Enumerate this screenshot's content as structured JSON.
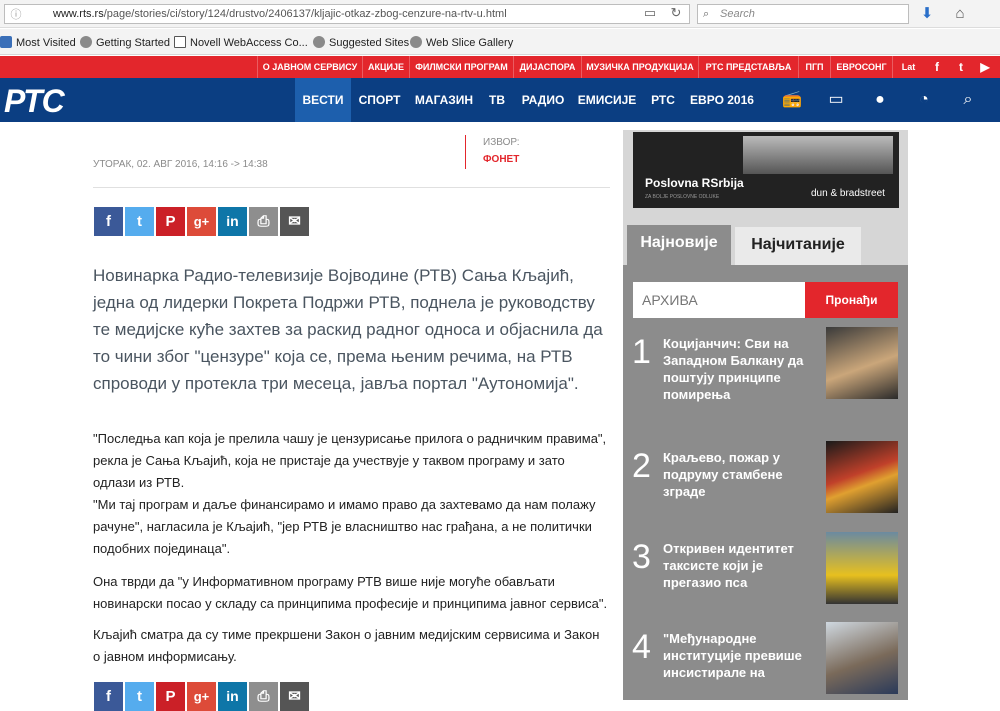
{
  "browser": {
    "url_host": "www.rts.rs",
    "url_path": "/page/stories/ci/story/124/drustvo/2406137/kljajic-otkaz-zbog-cenzure-na-rtv-u.html",
    "search_placeholder": "Search",
    "bookmarks": [
      "Most Visited",
      "Getting Started",
      "Novell WebAccess Co...",
      "Suggested Sites",
      "Web Slice Gallery"
    ]
  },
  "topnav": {
    "items": [
      "О ЈАВНОМ СЕРВИСУ",
      "АКЦИЈЕ",
      "ФИЛМСКИ ПРОГРАМ",
      "ДИЈАСПОРА",
      "МУЗИЧКА ПРОДУКЦИЈА",
      "РТС ПРЕДСТАВЉА",
      "ПГП",
      "ЕВРОСОНГ",
      "Lat"
    ],
    "social": [
      "f",
      "t",
      "▶"
    ]
  },
  "mainnav": {
    "logo": "РТС",
    "items": [
      "ВЕСТИ",
      "СПОРТ",
      "МАГАЗИН",
      "ТВ",
      "РАДИО",
      "ЕМИСИЈЕ",
      "РТС",
      "ЕВРО 2016"
    ]
  },
  "article": {
    "date": "УТОРАК, 02. АВГ 2016, 14:16 -> 14:38",
    "source_label": "ИЗВОР:",
    "source_value": "ФОНЕТ",
    "share_buttons": [
      "f",
      "t",
      "P",
      "g+",
      "in",
      "⎙",
      "✉"
    ],
    "lead": "Новинарка Радио-телевизије Војводине (РТВ) Сања Кљајић, једна од лидерки Покрета Подржи РТВ, поднела је руководству те медијске куће захтев за раскид радног односа и објаснила да то чини због \"цензуре\" која се, према њеним речима, на РТВ спроводи у протекла три месеца, јавља портал \"Аутономија\".",
    "paragraphs": [
      "\"Последња кап која је прелила чашу је цензурисање прилога о радничким правима\", рекла је Сања Кљајић, која не пристаје да учествује у таквом програму и зато одлази из РТВ.",
      "\"Ми тај програм и даље финансирамо и имамо право да захтевамо да нам полажу рачуне\", нагласила је Кљајић, \"јер РТВ је власништво нас грађана, а не политички подобних појединаца\".",
      "Она тврди да \"у Информативном програму РТВ више није могуће обављати новинарски посао у складу са принципима професије и принципима јавног сервиса\".",
      "Кљајић сматра да су тиме прекршени Закон о јавним медијским сервисима и Закон о јавном информисању."
    ]
  },
  "sidebar": {
    "ad_brand": "Poslovna RSrbija",
    "ad_sub": "ZA BOLJE POSLOVNE ODLUKE",
    "ad_partner": "dun & bradstreet",
    "tab_newest": "Најновије",
    "tab_most_read": "Најчитаније",
    "archive_placeholder": "АРХИВА",
    "archive_button": "Пронађи",
    "news": [
      {
        "num": "1",
        "title": "Коцијанчич: Сви на Западном Балкану да поштују принципе помирења"
      },
      {
        "num": "2",
        "title": "Краљево, пожар у подруму стамбене зграде"
      },
      {
        "num": "3",
        "title": "Откривен идентитет таксисте који је прегазио пса"
      },
      {
        "num": "4",
        "title": "\"Међународне институције превише инсистирале на"
      }
    ]
  },
  "colors": {
    "red": "#e3262c",
    "navy": "#0b3e82",
    "facebook": "#3b5998",
    "twitter": "#55acee",
    "pinterest": "#cb2027",
    "google": "#dd4b39",
    "linkedin": "#0e76a8"
  }
}
